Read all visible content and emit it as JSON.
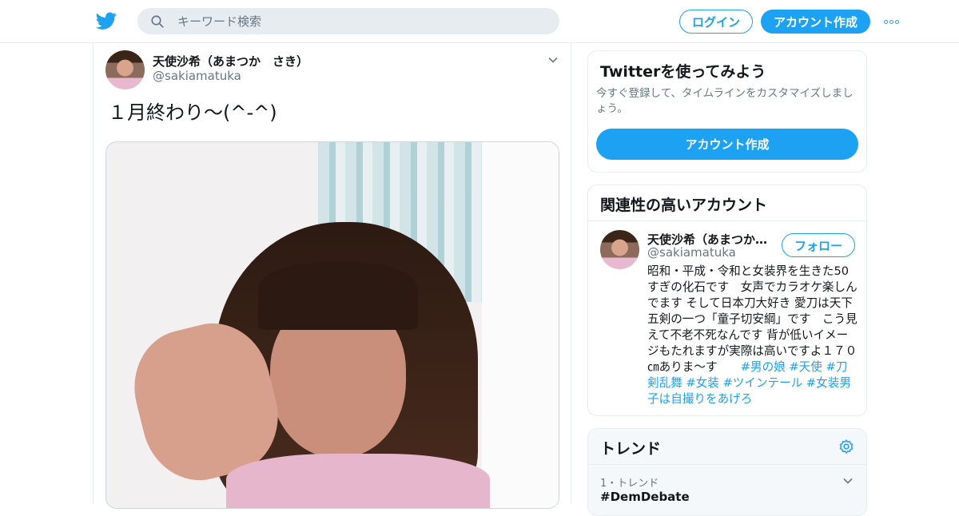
{
  "topbar": {
    "logo_icon": "twitter-bird-icon",
    "search_placeholder": "キーワード検索",
    "login_label": "ログイン",
    "signup_label": "アカウント作成",
    "more_icon": "more-dots-icon"
  },
  "tweet": {
    "display_name": "天使沙希（あまつか　さき）",
    "handle": "@sakiamatuka",
    "text": "１月終わり〜(^-^)"
  },
  "try_twitter": {
    "title": "Twitterを使ってみよう",
    "description": "今すぐ登録して、タイムラインをカスタマイズしましょう。",
    "button_label": "アカウント作成"
  },
  "related": {
    "title": "関連性の高いアカウント",
    "account": {
      "display_name": "天使沙希（あまつか…",
      "handle": "@sakiamatuka",
      "follow_label": "フォロー",
      "bio_text": "昭和・平成・令和と女装界を生きた50すぎの化石です　女声でカラオケ楽しんでます そして日本刀大好き 愛刀は天下五剣の一つ「童子切安綱」です　こう見えて不老不死なんです 背が低いイメージもたれますが実際は高いですよ１７０㎝ありま～す　　",
      "bio_tags": "#男の娘 #天使 #刀剣乱舞 #女装 #ツインテール #女装男子は自撮りをあげろ"
    }
  },
  "trends": {
    "title": "トレンド",
    "settings_icon": "gear-icon",
    "items": [
      {
        "meta": "1・トレンド",
        "name": "#DemDebate"
      }
    ]
  },
  "colors": {
    "accent": "#1da1f2",
    "text": "#14171a",
    "muted": "#657786",
    "border": "#e6ecf0"
  }
}
